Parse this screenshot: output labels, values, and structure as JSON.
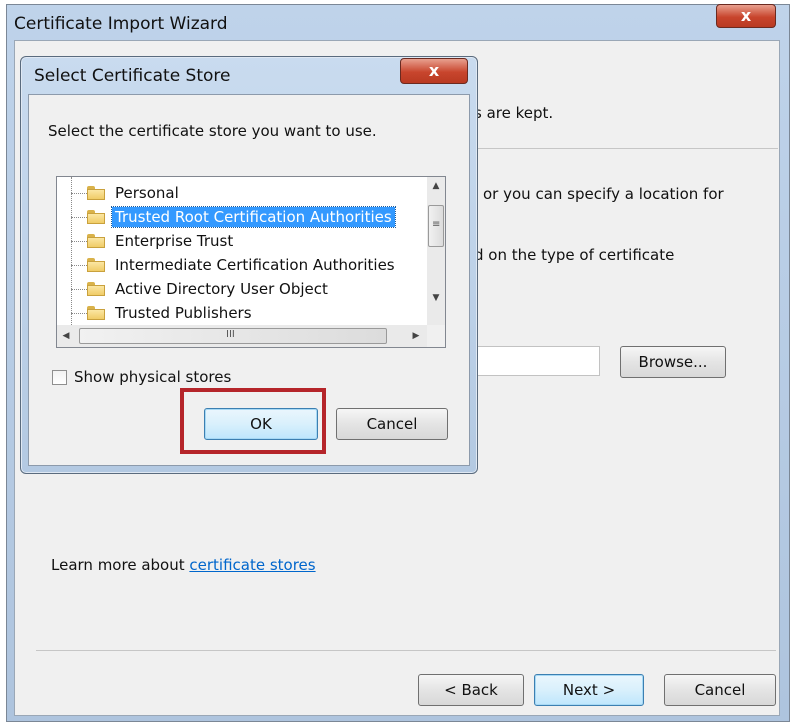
{
  "wizard": {
    "title": "Certificate Import Wizard",
    "close_glyph": "x",
    "text_fragments": {
      "stores_kept": "s are kept.",
      "specify_location": "or you can specify a location for",
      "type_of_certificate": "d on the type of certificate"
    },
    "browse_label": "Browse...",
    "learn_more_prefix": "Learn more about ",
    "learn_more_link": "certificate stores",
    "back_label": "< Back",
    "next_label": "Next >",
    "cancel_label": "Cancel"
  },
  "dialog": {
    "title": "Select Certificate Store",
    "close_glyph": "x",
    "prompt": "Select the certificate store you want to use.",
    "stores": [
      {
        "label": "Personal",
        "selected": false
      },
      {
        "label": "Trusted Root Certification Authorities",
        "selected": true
      },
      {
        "label": "Enterprise Trust",
        "selected": false
      },
      {
        "label": "Intermediate Certification Authorities",
        "selected": false
      },
      {
        "label": "Active Directory User Object",
        "selected": false
      },
      {
        "label": "Trusted Publishers",
        "selected": false
      }
    ],
    "show_physical_label": "Show physical stores",
    "show_physical_checked": false,
    "ok_label": "OK",
    "cancel_label": "Cancel",
    "scroll_grip": "≡",
    "hscroll_grip": "III"
  },
  "colors": {
    "selection": "#3399ff",
    "link": "#0066cc",
    "highlight_box": "#b5252a",
    "close_button": "#c8452d"
  },
  "icons": [
    "folder-icon",
    "scroll-up-icon",
    "scroll-down-icon",
    "scroll-left-icon",
    "scroll-right-icon",
    "close-icon"
  ]
}
